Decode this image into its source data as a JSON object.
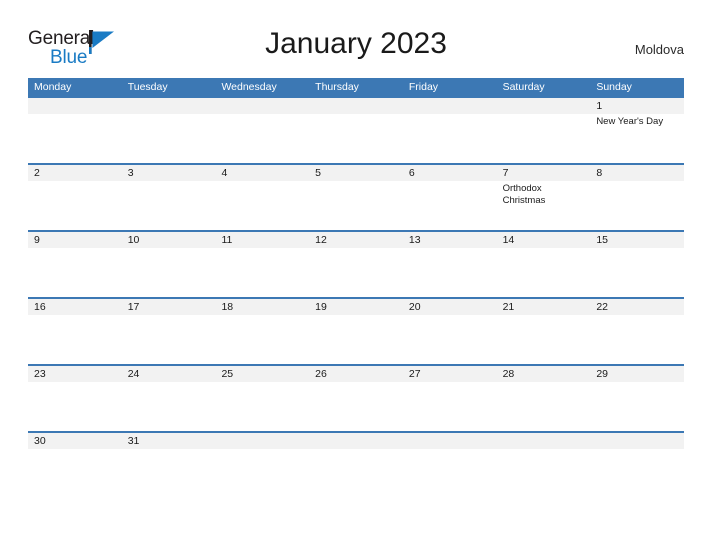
{
  "brand": {
    "name_part1": "General",
    "name_part2": "Blue",
    "flag_icon": "blue-flag-icon",
    "colors": {
      "dark": "#231f20",
      "blue": "#1a7bc4"
    }
  },
  "header": {
    "title": "January 2023",
    "country": "Moldova"
  },
  "theme": {
    "header_blue": "#3c78b4",
    "row_border_blue": "#3c78b4",
    "date_band_gray": "#f2f2f2",
    "text_dark": "#1a1a1a",
    "weekday_text": "#ffffff"
  },
  "calendar": {
    "weekdays": [
      "Monday",
      "Tuesday",
      "Wednesday",
      "Thursday",
      "Friday",
      "Saturday",
      "Sunday"
    ],
    "weeks": [
      [
        {
          "date": "",
          "events": []
        },
        {
          "date": "",
          "events": []
        },
        {
          "date": "",
          "events": []
        },
        {
          "date": "",
          "events": []
        },
        {
          "date": "",
          "events": []
        },
        {
          "date": "",
          "events": []
        },
        {
          "date": "1",
          "events": [
            "New Year's Day"
          ]
        }
      ],
      [
        {
          "date": "2",
          "events": []
        },
        {
          "date": "3",
          "events": []
        },
        {
          "date": "4",
          "events": []
        },
        {
          "date": "5",
          "events": []
        },
        {
          "date": "6",
          "events": []
        },
        {
          "date": "7",
          "events": [
            "Orthodox Christmas"
          ]
        },
        {
          "date": "8",
          "events": []
        }
      ],
      [
        {
          "date": "9",
          "events": []
        },
        {
          "date": "10",
          "events": []
        },
        {
          "date": "11",
          "events": []
        },
        {
          "date": "12",
          "events": []
        },
        {
          "date": "13",
          "events": []
        },
        {
          "date": "14",
          "events": []
        },
        {
          "date": "15",
          "events": []
        }
      ],
      [
        {
          "date": "16",
          "events": []
        },
        {
          "date": "17",
          "events": []
        },
        {
          "date": "18",
          "events": []
        },
        {
          "date": "19",
          "events": []
        },
        {
          "date": "20",
          "events": []
        },
        {
          "date": "21",
          "events": []
        },
        {
          "date": "22",
          "events": []
        }
      ],
      [
        {
          "date": "23",
          "events": []
        },
        {
          "date": "24",
          "events": []
        },
        {
          "date": "25",
          "events": []
        },
        {
          "date": "26",
          "events": []
        },
        {
          "date": "27",
          "events": []
        },
        {
          "date": "28",
          "events": []
        },
        {
          "date": "29",
          "events": []
        }
      ],
      [
        {
          "date": "30",
          "events": []
        },
        {
          "date": "31",
          "events": []
        },
        {
          "date": "",
          "events": []
        },
        {
          "date": "",
          "events": []
        },
        {
          "date": "",
          "events": []
        },
        {
          "date": "",
          "events": []
        },
        {
          "date": "",
          "events": []
        }
      ]
    ]
  }
}
